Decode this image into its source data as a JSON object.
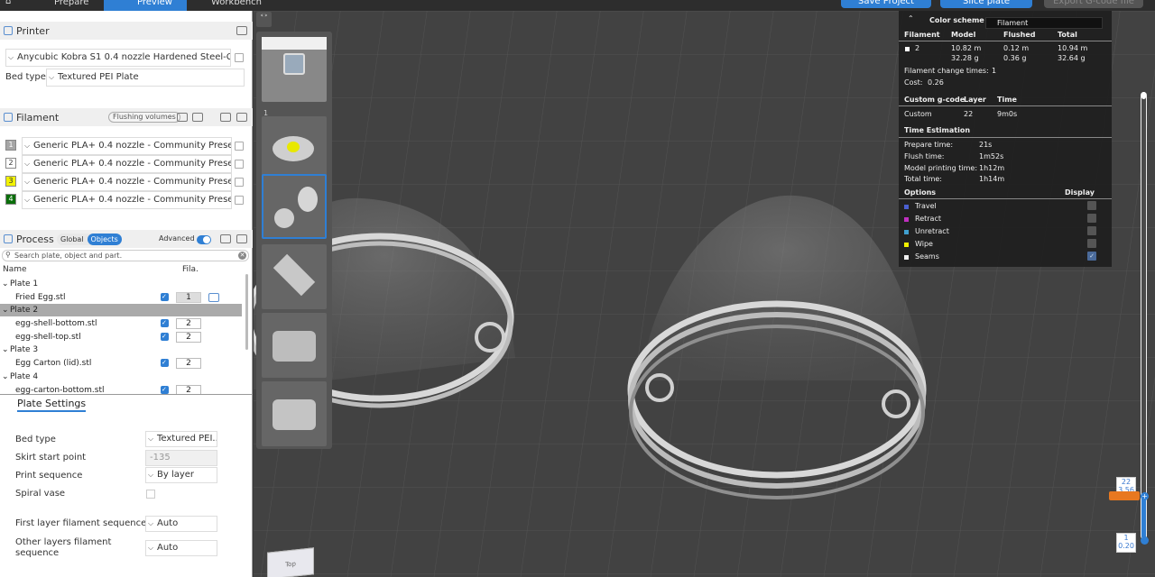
{
  "topbar": {
    "tabs": [
      {
        "label": "Prepare"
      },
      {
        "label": "Preview"
      },
      {
        "label": "Workbench"
      }
    ],
    "save_label": "Save Project",
    "slice_label": "Slice plate",
    "export_label": "Export G-code file"
  },
  "printer": {
    "title": "Printer",
    "name": "Anycubic Kobra S1 0.4 nozzle Hardened Steel-Co...",
    "bed_label": "Bed type",
    "bed_value": "Textured PEI Plate"
  },
  "filament": {
    "title": "Filament",
    "flushing_label": "Flushing volumes",
    "items": [
      {
        "num": "1",
        "name": "Generic PLA+ 0.4 nozzle - Community Preset",
        "color": "#a6a6a6"
      },
      {
        "num": "2",
        "name": "Generic PLA+ 0.4 nozzle - Community Preset",
        "color": "#ffffff"
      },
      {
        "num": "3",
        "name": "Generic PLA+ 0.4 nozzle - Community Preset",
        "color": "#f2f200"
      },
      {
        "num": "4",
        "name": "Generic PLA+ 0.4 nozzle - Community Preset",
        "color": "#0a6e0a"
      }
    ]
  },
  "process": {
    "title": "Process",
    "global_label": "Global",
    "objects_label": "Objects",
    "advanced_label": "Advanced",
    "search_placeholder": "Search plate, object and part.",
    "col_name": "Name",
    "col_fila": "Fila.",
    "tree": [
      {
        "label": "Plate 1",
        "kind": "plate"
      },
      {
        "label": "Fried Egg.stl",
        "kind": "obj",
        "fila": "1"
      },
      {
        "label": "Plate 2",
        "kind": "plate"
      },
      {
        "label": "egg-shell-bottom.stl",
        "kind": "obj",
        "fila": "2"
      },
      {
        "label": "egg-shell-top.stl",
        "kind": "obj",
        "fila": "2"
      },
      {
        "label": "Plate 3",
        "kind": "plate"
      },
      {
        "label": "Egg Carton (lid).stl",
        "kind": "obj",
        "fila": "2"
      },
      {
        "label": "Plate 4",
        "kind": "plate"
      },
      {
        "label": "egg-carton-bottom.stl",
        "kind": "obj",
        "fila": "2"
      }
    ]
  },
  "plate_settings": {
    "tab_label": "Plate Settings",
    "bed_type_label": "Bed type",
    "bed_type_value": "Textured PEI...",
    "skirt_label": "Skirt start point",
    "skirt_value": "-135",
    "print_seq_label": "Print sequence",
    "print_seq_value": "By layer",
    "spiral_label": "Spiral vase",
    "first_layer_label": "First layer filament sequence",
    "first_layer_value": "Auto",
    "other_layers_label_1": "Other layers filament",
    "other_layers_label_2": "sequence",
    "other_layers_value": "Auto"
  },
  "thumbnails": {
    "plate1_num": "1"
  },
  "stats": {
    "color_scheme_label": "Color scheme",
    "color_scheme_value": "Filament",
    "h_filament": "Filament",
    "h_model": "Model",
    "h_flushed": "Flushed",
    "h_total": "Total",
    "fil_num": "2",
    "model_m": "10.82 m",
    "model_g": "32.28 g",
    "flushed_m": "0.12 m",
    "flushed_g": "0.36 g",
    "total_m": "10.94 m",
    "total_g": "32.64 g",
    "change_times_label": "Filament change times:",
    "change_times_value": "1",
    "cost_label": "Cost:",
    "cost_value": "0.26",
    "h_custom_gcode": "Custom g-code",
    "h_layer": "Layer",
    "h_time": "Time",
    "custom_label": "Custom",
    "custom_layer": "22",
    "custom_time": "9m0s",
    "time_est_label": "Time Estimation",
    "prepare_label": "Prepare time:",
    "prepare_value": "21s",
    "flush_label": "Flush time:",
    "flush_value": "1m52s",
    "model_print_label": "Model printing time:",
    "model_print_value": "1h12m",
    "total_time_label": "Total time:",
    "total_time_value": "1h14m",
    "options_label": "Options",
    "display_label": "Display",
    "options": [
      {
        "label": "Travel",
        "color": "#4a5fd0"
      },
      {
        "label": "Retract",
        "color": "#c030c0"
      },
      {
        "label": "Unretract",
        "color": "#40a0d0"
      },
      {
        "label": "Wipe",
        "color": "#f0f000"
      },
      {
        "label": "Seams",
        "color": "#f0f0f0"
      }
    ]
  },
  "slider": {
    "top_layer": "22",
    "top_height": "3.56",
    "bottom_layer": "1",
    "bottom_height": "0.20"
  },
  "view_cube": {
    "label": "Top"
  }
}
